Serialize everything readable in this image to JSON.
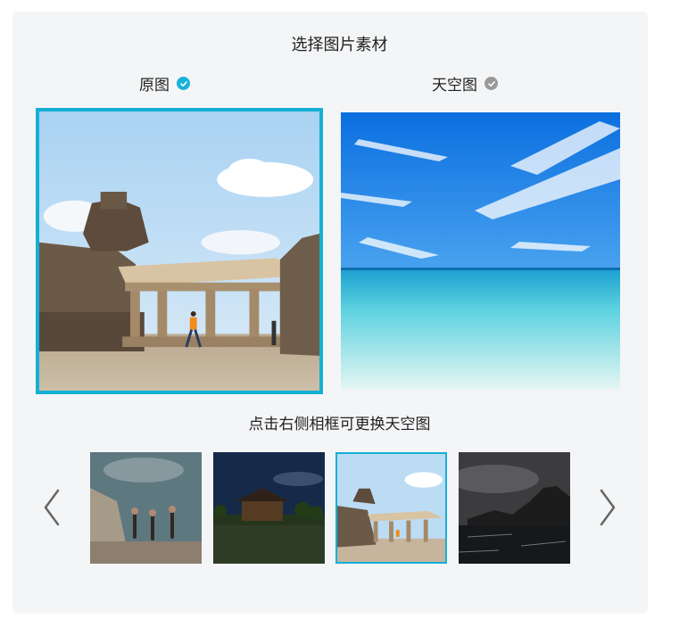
{
  "header": {
    "title": "选择图片素材"
  },
  "labels": {
    "original": "原图",
    "sky": "天空图"
  },
  "hint": "点击右侧相框可更换天空图",
  "carousel": {
    "items": [
      {
        "name": "friends-jumping-beach",
        "selected": false
      },
      {
        "name": "forbidden-city-tower",
        "selected": false
      },
      {
        "name": "temple-ruins",
        "selected": true
      },
      {
        "name": "dark-sea-cliffs",
        "selected": false
      }
    ]
  },
  "colors": {
    "accent": "#14b0d4",
    "check_on": "#1ab2d8",
    "check_off": "#9a9a9a",
    "panel": "#f4f5f7"
  },
  "icons": {
    "prev": "chevron-left-icon",
    "next": "chevron-right-icon",
    "check": "check-circle-icon"
  }
}
